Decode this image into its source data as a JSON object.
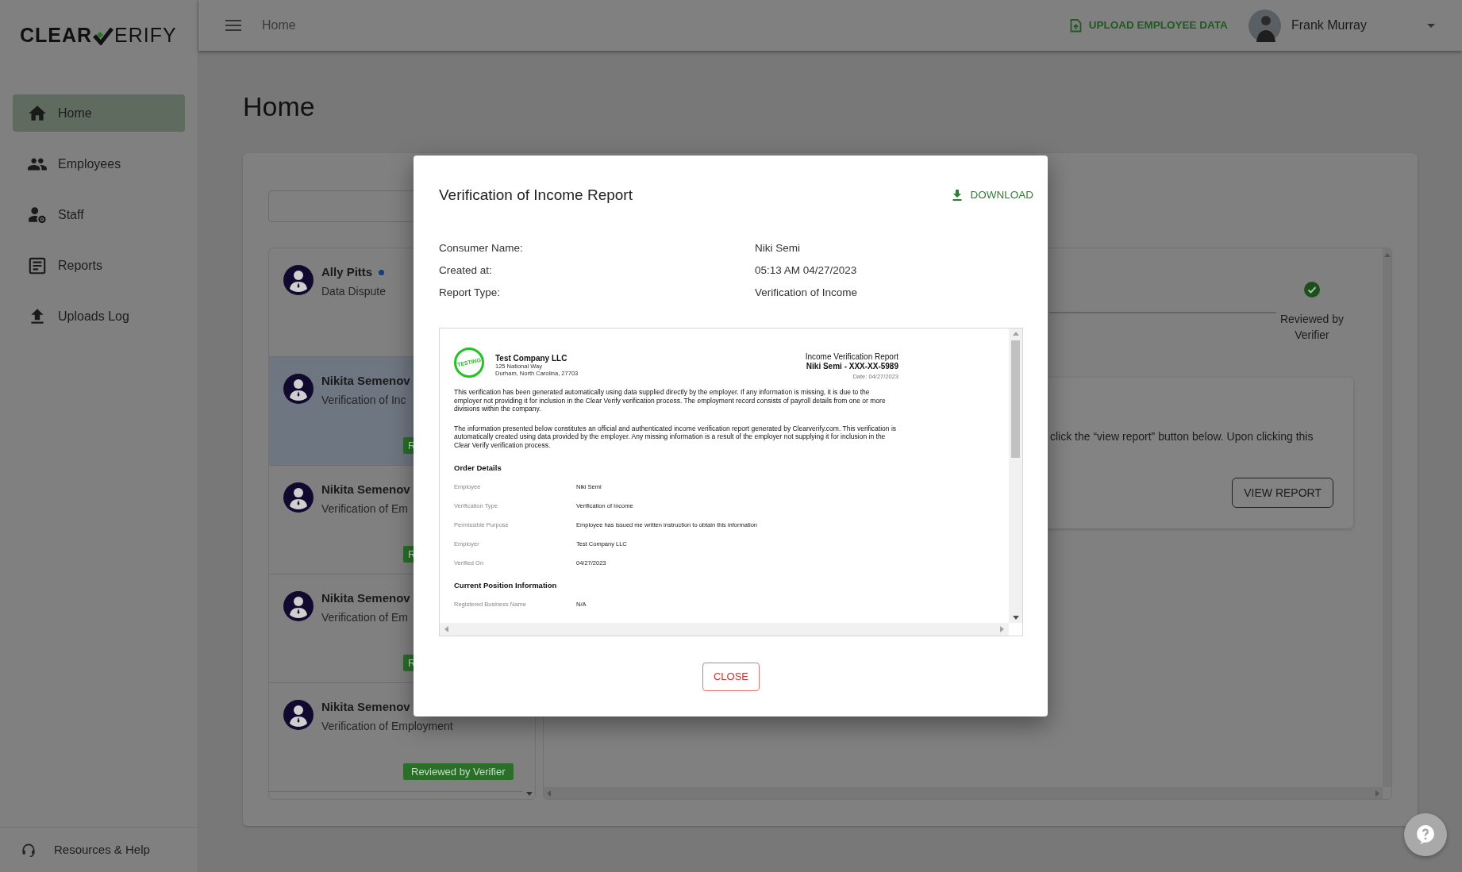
{
  "sidebar": {
    "logo": {
      "left": "CLEAR",
      "right": "ERIFY"
    },
    "items": [
      {
        "label": "Home",
        "kind": "home",
        "selected": true
      },
      {
        "label": "Employees",
        "kind": "people",
        "selected": false
      },
      {
        "label": "Staff",
        "kind": "staff",
        "selected": false
      },
      {
        "label": "Reports",
        "kind": "reports",
        "selected": false
      },
      {
        "label": "Uploads Log",
        "kind": "upload",
        "selected": false
      }
    ],
    "footer": {
      "label": "Resources & Help"
    }
  },
  "topbar": {
    "breadcrumb": "Home",
    "upload_label": "UPLOAD EMPLOYEE DATA",
    "user_name": "Frank Murray"
  },
  "page_title": "Home",
  "requests": [
    {
      "name": "Ally Pitts",
      "subtitle": "Data Dispute",
      "unread": true,
      "selected": false
    },
    {
      "name": "Nikita Semenov",
      "subtitle": "Verification of Inc",
      "selected": true,
      "badge": {
        "kind": "cut",
        "label": "R"
      }
    },
    {
      "name": "Nikita Semenov",
      "subtitle": "Verification of Em",
      "selected": false,
      "badge": {
        "kind": "cut",
        "label": "R"
      }
    },
    {
      "name": "Nikita Semenov",
      "subtitle": "Verification of Em",
      "selected": false,
      "badge": {
        "kind": "cut",
        "label": "R"
      }
    },
    {
      "name": "Nikita Semenov",
      "subtitle": "Verification of Employment",
      "selected": false,
      "badge": {
        "kind": "full",
        "label": "Reviewed by Verifier"
      }
    }
  ],
  "detail": {
    "step_label": "Reviewed by Verifier",
    "instructions": "click the “view report” button below. Upon clicking this",
    "button": "VIEW REPORT"
  },
  "modal": {
    "title": "Verification of Income Report",
    "download": "DOWNLOAD",
    "fields": [
      {
        "label": "Consumer Name:",
        "value": "Niki Semi"
      },
      {
        "label": "Created at:",
        "value": "05:13 AM 04/27/2023"
      },
      {
        "label": "Report Type:",
        "value": "Verification of Income"
      }
    ],
    "document": {
      "stamp_text": "TESTING",
      "company": "Test Company LLC",
      "address_lines": [
        "125 National Way",
        "Durham, North Carolina, 27703"
      ],
      "title": "Income Verification Report",
      "subtitle": "Niki Semi - XXX-XX-5989",
      "date": "Date: 04/27/2023",
      "paragraphs": [
        "This verification has been generated automatically using data supplied directly by the employer. If any information is missing, it is due to the employer not providing it for inclusion in the Clear Verify verification process. The employment record consists of payroll details from one or more divisions within the company.",
        "The information presented below constitutes an official and authenticated income verification report generated by Clearverify.com. This verification is automatically created using data provided by the employer. Any missing information is a result of the employer not supplying it for inclusion in the Clear Verify verification process."
      ],
      "sections": [
        {
          "heading": "Order Details",
          "rows": [
            {
              "label": "Employee",
              "value": "Niki Semi"
            },
            {
              "label": "Verification Type",
              "value": "Verification of Income"
            },
            {
              "label": "Permissible Purpose",
              "value": "Employee has issued me written instruction to obtain this information"
            },
            {
              "label": "Employer",
              "value": "Test Company LLC"
            },
            {
              "label": "Verified On",
              "value": "04/27/2023"
            }
          ]
        },
        {
          "heading": "Current Position Information",
          "rows": [
            {
              "label": "Registered Business Name",
              "value": "N/A"
            }
          ]
        }
      ]
    },
    "close": "CLOSE"
  }
}
